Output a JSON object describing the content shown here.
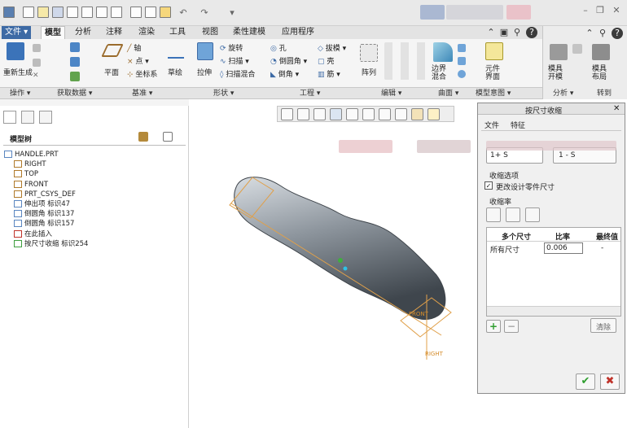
{
  "menu": {
    "file": "文件",
    "items": [
      "模型",
      "分析",
      "注释",
      "渲染",
      "工具",
      "视图",
      "柔性建模",
      "应用程序"
    ]
  },
  "ribbon": {
    "regen": "重新生成",
    "plane": "平面",
    "axis": "轴",
    "point": "点",
    "csys": "坐标系",
    "sketch": "草绘",
    "extrude": "拉伸",
    "revolve": "旋转",
    "sweep": "扫描",
    "swept_blend": "扫描混合",
    "hole": "孔",
    "round": "倒圆角",
    "chamfer": "倒角",
    "draft": "拔模",
    "shell": "壳",
    "rib": "筋",
    "pattern": "阵列",
    "boundary_blend": "边界混合",
    "component_ui": "元件界面",
    "mold_open": "模具开模",
    "mold_layout": "模具布局"
  },
  "groups": {
    "operations": "操作",
    "get_data": "获取数据",
    "datum": "基准",
    "shapes": "形状",
    "engineering": "工程",
    "editing": "编辑",
    "surfaces": "曲面",
    "model_intent": "模型意图",
    "analysis": "分析",
    "goto": "转到"
  },
  "tree": {
    "title": "模型树",
    "items": [
      {
        "label": "HANDLE.PRT",
        "icon": "part-icon",
        "indent": 0
      },
      {
        "label": "RIGHT",
        "icon": "datum-plane-icon",
        "indent": 1
      },
      {
        "label": "TOP",
        "icon": "datum-plane-icon",
        "indent": 1
      },
      {
        "label": "FRONT",
        "icon": "datum-plane-icon",
        "indent": 1
      },
      {
        "label": "PRT_CSYS_DEF",
        "icon": "csys-icon",
        "indent": 1
      },
      {
        "label": "伸出项 标识47",
        "icon": "protrusion-icon",
        "indent": 1
      },
      {
        "label": "倒圆角 标识137",
        "icon": "round-icon",
        "indent": 1
      },
      {
        "label": "倒圆角 标识157",
        "icon": "round-icon",
        "indent": 1
      },
      {
        "label": "在此插入",
        "icon": "insert-here-icon",
        "indent": 1
      },
      {
        "label": "按尺寸收缩 标识254",
        "icon": "shrink-icon",
        "indent": 1
      }
    ]
  },
  "model_labels": {
    "front": "FRONT",
    "right": "RIGHT"
  },
  "dialog": {
    "title": "按尺寸收缩",
    "menus": [
      "文件",
      "特征"
    ],
    "formula_1": "1+ S",
    "formula_2": "1 - S",
    "options_title": "收缩选项",
    "change_dims": "更改设计零件尺寸",
    "rate_title": "收缩率",
    "col_dims": "多个尺寸",
    "col_ratio": "比率",
    "col_final": "最终值",
    "row_label": "所有尺寸",
    "row_value": "0.006",
    "row_final": "-",
    "clear": "清除"
  }
}
